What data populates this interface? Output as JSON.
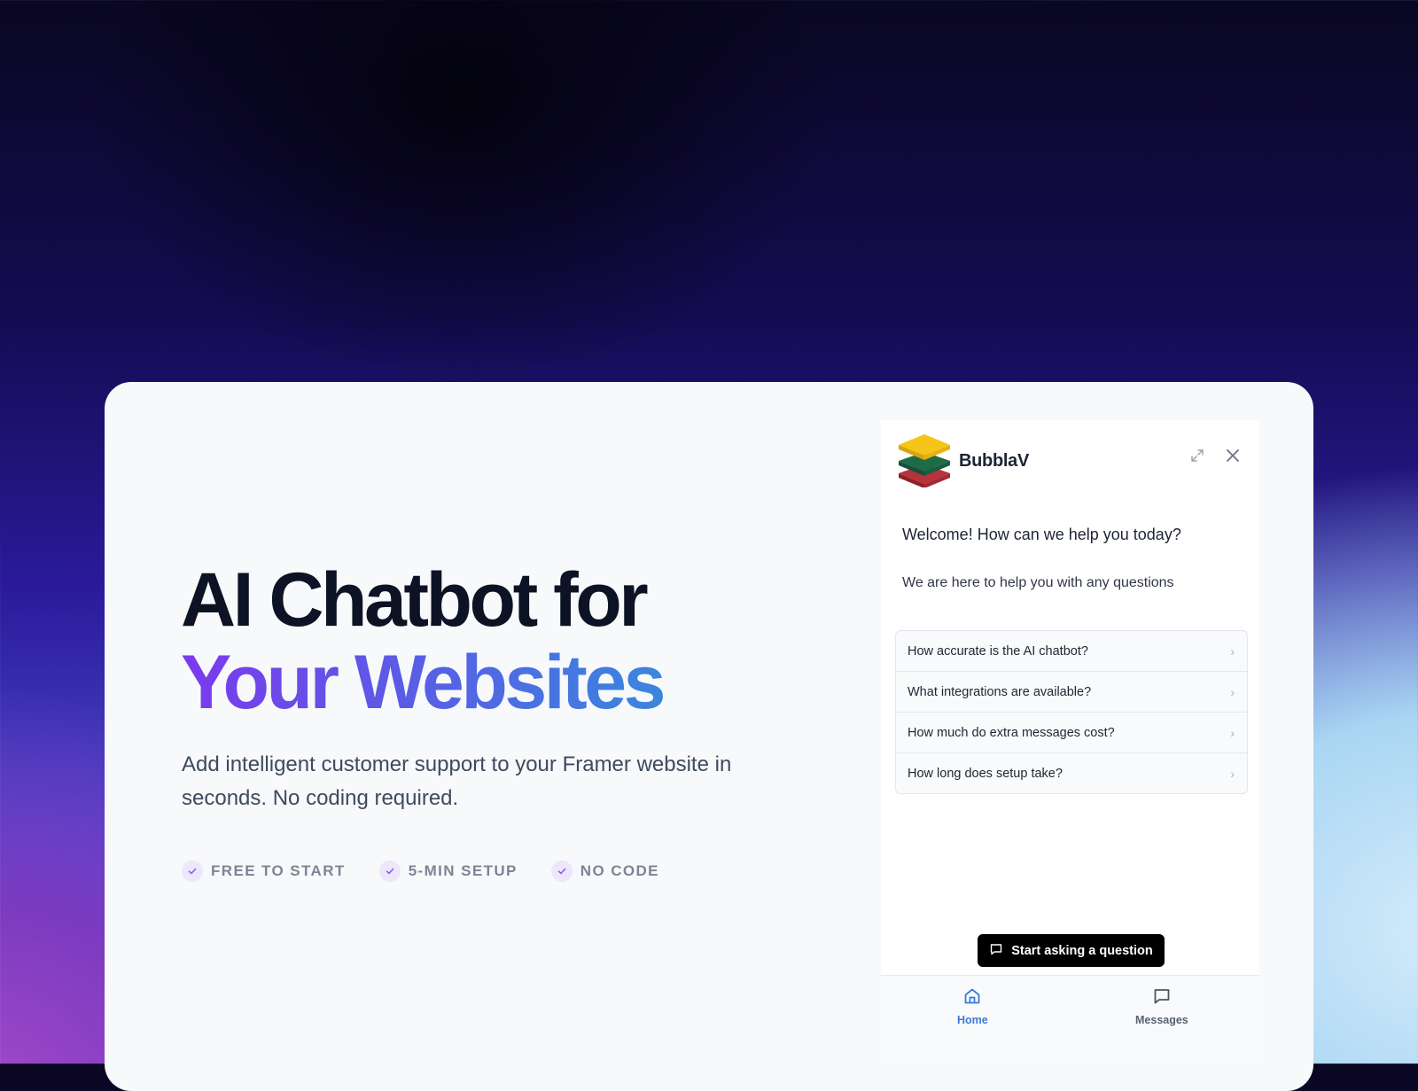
{
  "hero": {
    "title_line1": "AI Chatbot for",
    "title_line2": "Your Websites",
    "subtitle": "Add intelligent customer support to your Framer website in seconds. No coding required.",
    "features": [
      "FREE TO START",
      "5-MIN SETUP",
      "NO CODE"
    ]
  },
  "widget": {
    "brand": "BubblaV",
    "welcome": "Welcome! How can we help you today?",
    "helper": "We are here to help you with any questions",
    "faqs": [
      "How accurate is the AI chatbot?",
      "What integrations are available?",
      "How much do extra messages cost?",
      "How long does setup take?"
    ],
    "cta_label": "Start asking a question",
    "nav": {
      "home": "Home",
      "messages": "Messages"
    }
  },
  "colors": {
    "accent_purple": "#7c3aed",
    "accent_blue": "#3a86dd",
    "nav_active": "#3a7bd5",
    "logo_yellow": "#f5c518",
    "logo_green": "#1f6b45",
    "logo_red": "#b8313b"
  },
  "icons": [
    "check-icon",
    "expand-icon",
    "close-icon",
    "chevron-right-icon",
    "chat-icon",
    "home-icon",
    "messages-icon"
  ]
}
